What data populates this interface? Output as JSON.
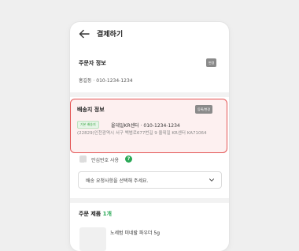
{
  "header": {
    "title": "결제하기"
  },
  "orderer": {
    "title": "주문자 정보",
    "change_label": "변경",
    "info": "홍길동 · 010-1234-1234"
  },
  "shipping": {
    "title": "배송지 정보",
    "change_label": "등록/변경",
    "default_tag": "기본 배송지",
    "recipient": "올데일KR센터 · 010-1234-1234",
    "address": "(22829)인천광역시 서구 백범로677번길 9 올데일 KR센터 KA71064"
  },
  "safe_number": {
    "label": "안심번호 사용",
    "help_icon": "?"
  },
  "delivery_request": {
    "placeholder": "배송 요청사항을 선택해 주세요."
  },
  "products": {
    "title": "주문 제품",
    "count": "1개",
    "first_item_name": "노세범 미네랄 파우더 5g"
  },
  "colors": {
    "accent": "#29a855",
    "highlight_border": "#e45454",
    "highlight_bg": "#fdf0f0"
  }
}
